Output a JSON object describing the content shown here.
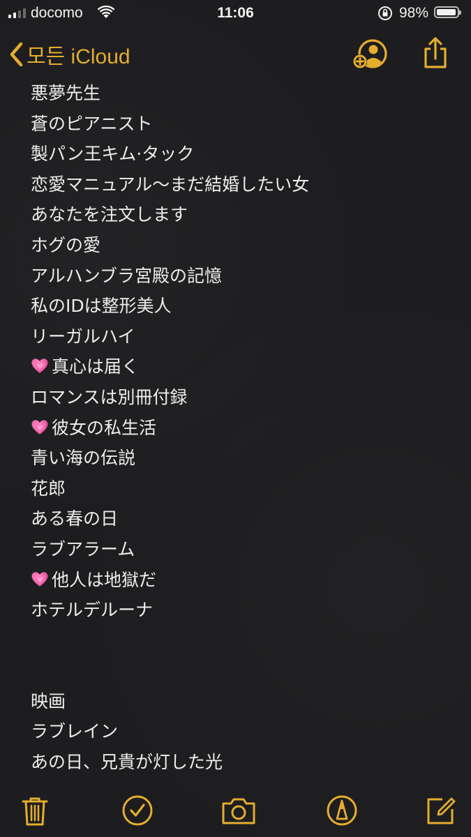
{
  "status_bar": {
    "carrier": "docomo",
    "time": "11:06",
    "battery_percent": "98%",
    "battery_level": 0.98,
    "signal_bars": 4,
    "signal_bars_active": 2
  },
  "nav": {
    "back_label": "모든 iCloud",
    "accent_color": "#e4ad2e",
    "right_icons": [
      "add-person-icon",
      "share-icon"
    ]
  },
  "note": {
    "lines": [
      {
        "text": "悪夢先生",
        "heart": false
      },
      {
        "text": "蒼のピアニスト",
        "heart": false
      },
      {
        "text": "製パン王キム·タック",
        "heart": false
      },
      {
        "text": "恋愛マニュアル〜まだ結婚したい女",
        "heart": false
      },
      {
        "text": "あなたを注文します",
        "heart": false
      },
      {
        "text": "ホグの愛",
        "heart": false
      },
      {
        "text": "アルハンブラ宮殿の記憶",
        "heart": false
      },
      {
        "text": "私のIDは整形美人",
        "heart": false
      },
      {
        "text": "リーガルハイ",
        "heart": false
      },
      {
        "text": "真心は届く",
        "heart": true
      },
      {
        "text": "ロマンスは別冊付録",
        "heart": false
      },
      {
        "text": "彼女の私生活",
        "heart": true
      },
      {
        "text": "青い海の伝説",
        "heart": false
      },
      {
        "text": "花郎",
        "heart": false
      },
      {
        "text": "ある春の日",
        "heart": false
      },
      {
        "text": "ラブアラーム",
        "heart": false
      },
      {
        "text": "他人は地獄だ",
        "heart": true
      },
      {
        "text": "ホテルデルーナ",
        "heart": false
      },
      {
        "text": "",
        "heart": false
      },
      {
        "text": "",
        "heart": false
      },
      {
        "text": "映画",
        "heart": false
      },
      {
        "text": "ラブレイン",
        "heart": false
      },
      {
        "text": "あの日、兄貴が灯した光",
        "heart": false
      }
    ]
  },
  "toolbar": {
    "icons": [
      "trash-icon",
      "checklist-icon",
      "camera-icon",
      "markup-icon",
      "compose-icon"
    ]
  }
}
